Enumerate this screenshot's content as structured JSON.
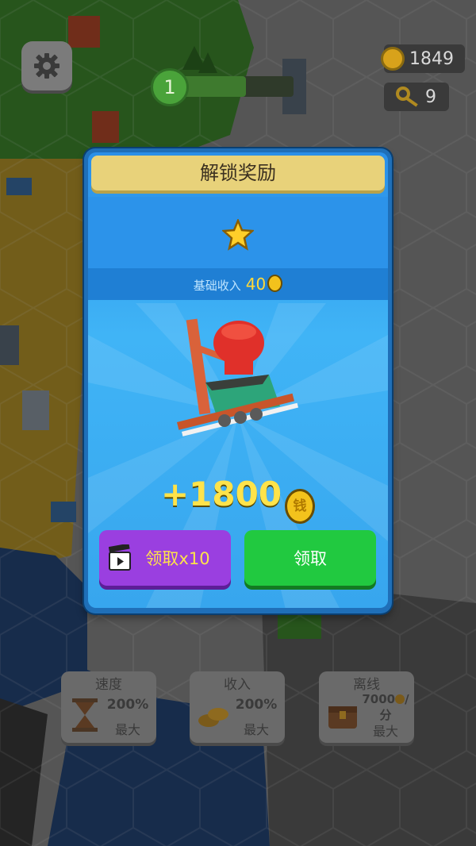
{
  "hud": {
    "level": "1",
    "coins": "1849",
    "keys": "9"
  },
  "boosts": [
    {
      "title": "速度",
      "value": "200%",
      "sub": "最大",
      "icon": "hourglass-icon"
    },
    {
      "title": "收入",
      "value": "200%",
      "sub": "最大",
      "icon": "coins-icon"
    },
    {
      "title": "离线",
      "value": "7000",
      "value_suffix": "/",
      "value_line2": "分",
      "sub": "最大",
      "icon": "chest-icon"
    }
  ],
  "modal": {
    "title": "解锁奖励",
    "star_icon": "star-icon",
    "income_label": "基础收入",
    "income_value": "40",
    "reward_amount": "+1800",
    "coin_glyph": "钱",
    "video_button_label": "领取x10",
    "claim_button_label": "领取"
  },
  "colors": {
    "modal_blue": "#37a6ee",
    "title_bar": "#e8d27a",
    "video_purple": "#9a3fe0",
    "claim_green": "#21c940",
    "reward_yellow": "#ffe34a"
  }
}
